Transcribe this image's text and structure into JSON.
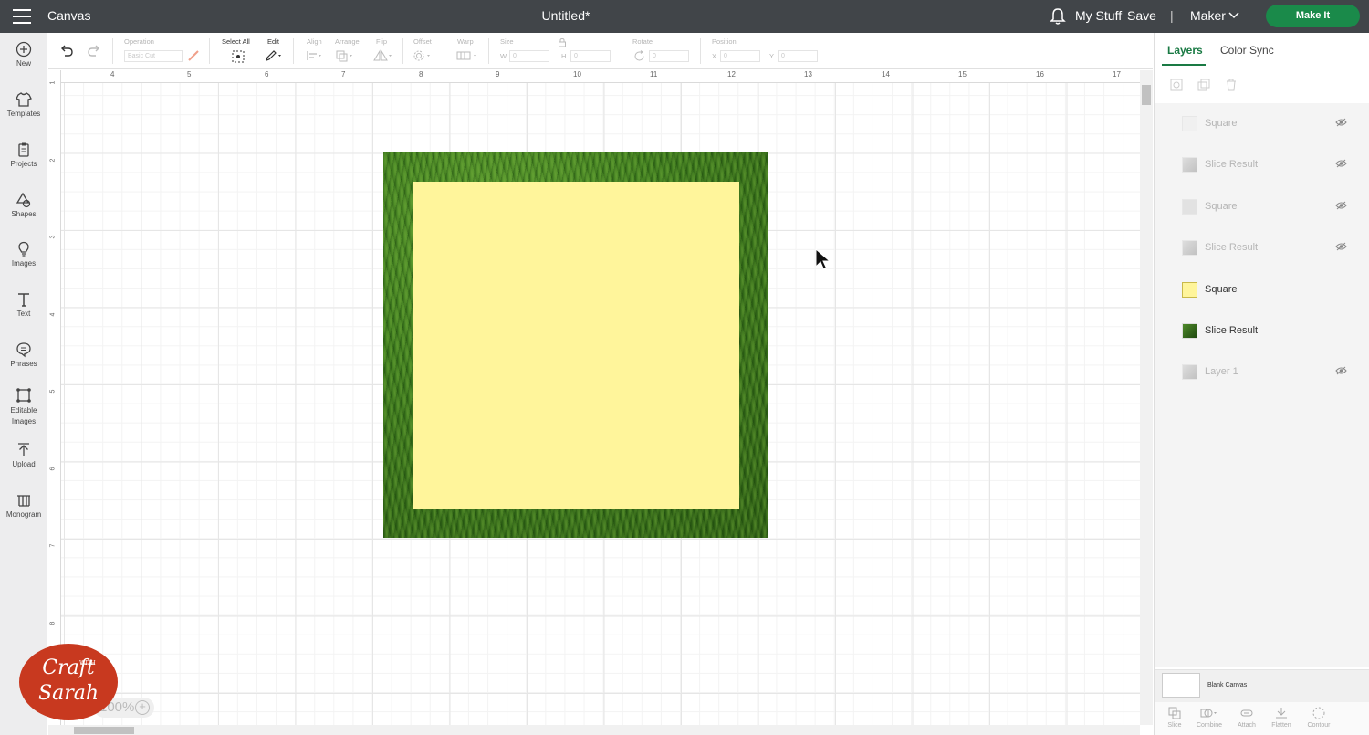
{
  "header": {
    "app_title": "Canvas",
    "doc_title": "Untitled*",
    "my_stuff": "My Stuff",
    "save": "Save",
    "separator": "|",
    "machine": "Maker",
    "make_it": "Make It",
    "make_it_color": "#1a8a4a"
  },
  "sidebar": {
    "items": [
      {
        "label": "New",
        "icon": "plus-circle-icon"
      },
      {
        "label": "Templates",
        "icon": "shirt-icon"
      },
      {
        "label": "Projects",
        "icon": "clipboard-icon"
      },
      {
        "label": "Shapes",
        "icon": "shapes-icon"
      },
      {
        "label": "Images",
        "icon": "lightbulb-icon"
      },
      {
        "label": "Text",
        "icon": "text-icon"
      },
      {
        "label": "Phrases",
        "icon": "speech-bubble-icon"
      },
      {
        "label": "Editable Images",
        "icon": "editable-image-icon"
      },
      {
        "label": "Upload",
        "icon": "upload-icon"
      },
      {
        "label": "Monogram",
        "icon": "monogram-icon"
      }
    ]
  },
  "toolbar": {
    "operation_label": "Operation",
    "operation_value": "Basic Cut",
    "select_all": "Select All",
    "edit": "Edit",
    "align": "Align",
    "arrange": "Arrange",
    "flip": "Flip",
    "offset": "Offset",
    "warp": "Warp",
    "size": "Size",
    "w": "W",
    "w_value": "0",
    "h": "H",
    "h_value": "0",
    "rotate": "Rotate",
    "rotate_value": "0",
    "position": "Position",
    "x": "X",
    "x_value": "0",
    "y": "Y",
    "y_value": "0"
  },
  "ruler": {
    "top": [
      "4",
      "5",
      "6",
      "7",
      "8",
      "9",
      "10",
      "11",
      "12",
      "13",
      "14",
      "15",
      "16",
      "17"
    ],
    "left": [
      "1",
      "2",
      "3",
      "4",
      "5",
      "6",
      "7",
      "8"
    ]
  },
  "canvas": {
    "zoom": "100%",
    "square_color": "#fff59b"
  },
  "right_panel": {
    "tabs": [
      "Layers",
      "Color Sync"
    ],
    "layers": [
      {
        "name": "Square",
        "hidden": true,
        "thumb": "#eeeeee"
      },
      {
        "name": "Slice Result",
        "hidden": true,
        "thumb": "image"
      },
      {
        "name": "Square",
        "hidden": true,
        "thumb": "#d4d4d4"
      },
      {
        "name": "Slice Result",
        "hidden": true,
        "thumb": "image"
      },
      {
        "name": "Square",
        "hidden": false,
        "thumb": "#fff59b"
      },
      {
        "name": "Slice Result",
        "hidden": false,
        "thumb": "grass"
      },
      {
        "name": "Layer 1",
        "hidden": true,
        "thumb": "image"
      }
    ],
    "blank_canvas": "Blank Canvas",
    "actions": [
      "Slice",
      "Combine",
      "Attach",
      "Flatten",
      "Contour"
    ]
  },
  "watermark": {
    "line1": "Craft",
    "with": "WITH",
    "line2": "Sarah"
  }
}
